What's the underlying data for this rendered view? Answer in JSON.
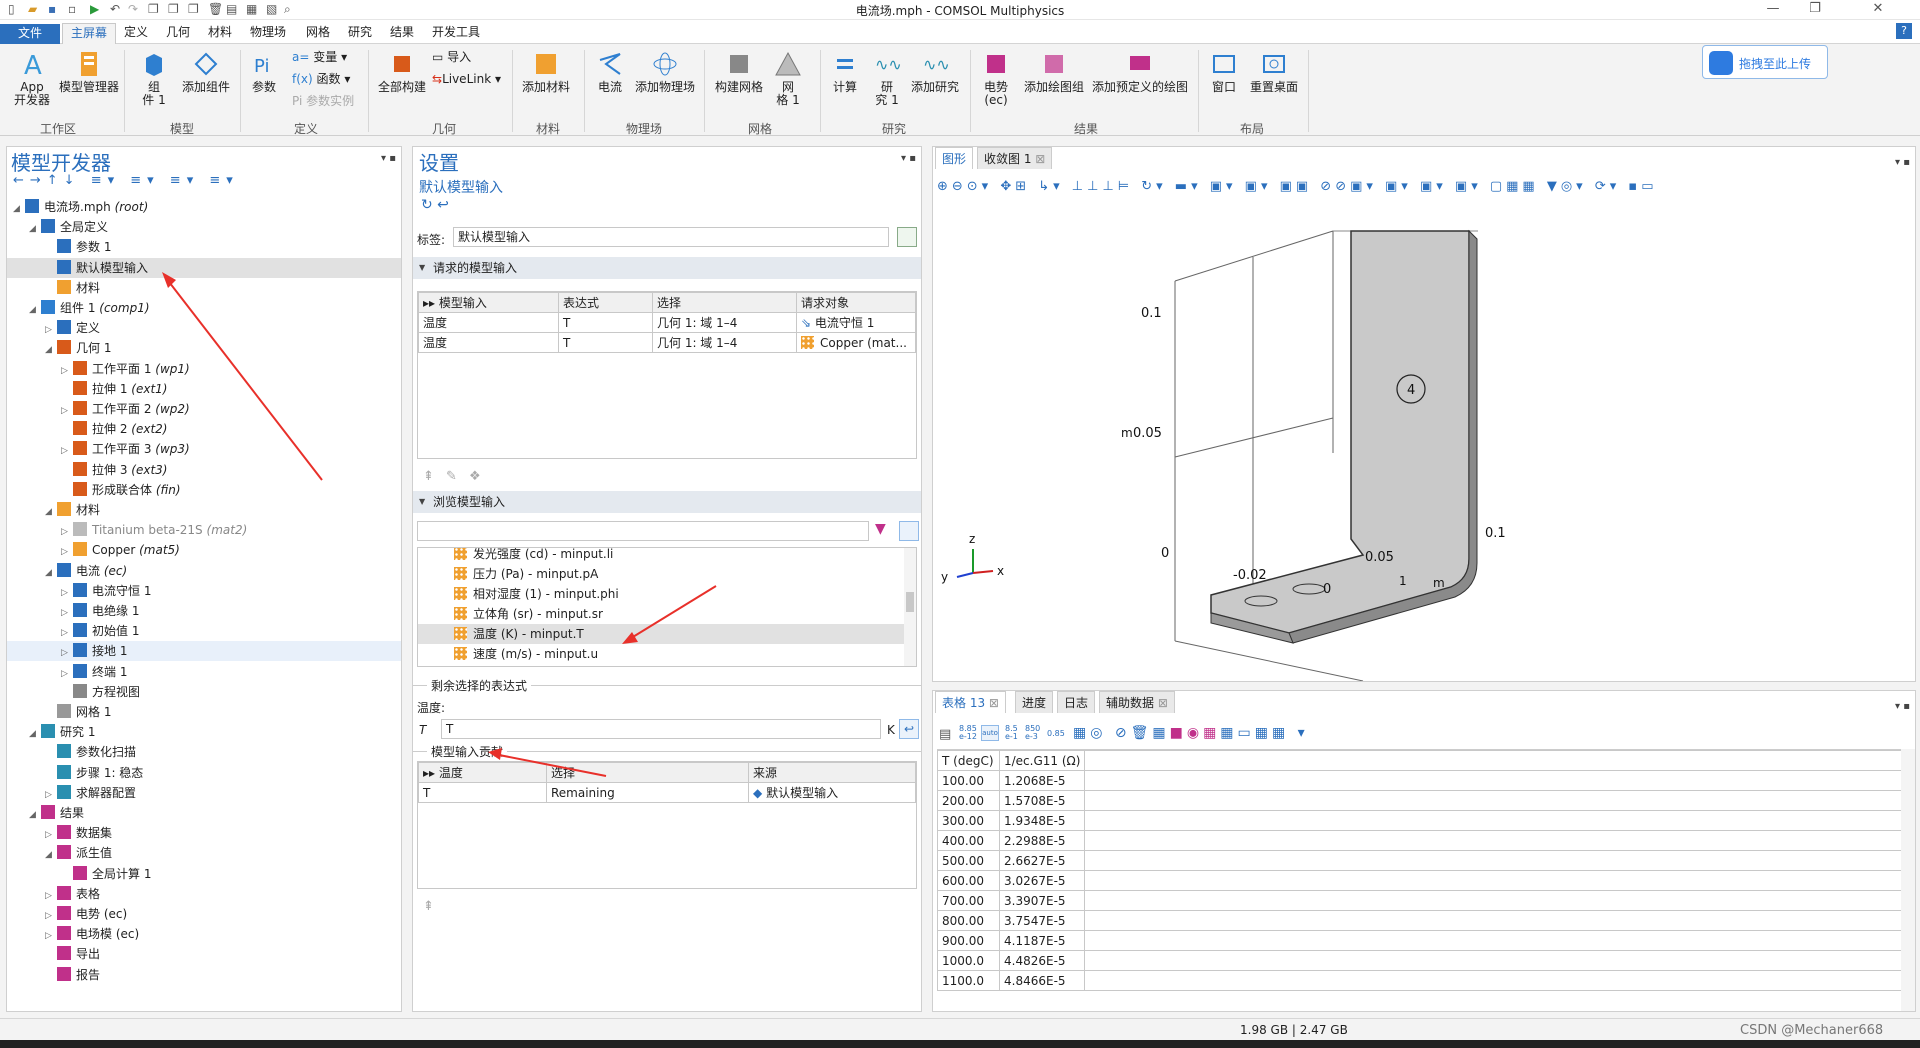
{
  "window": {
    "title": "电流场.mph - COMSOL Multiphysics"
  },
  "menu": {
    "tabs": [
      "文件",
      "主屏幕",
      "定义",
      "几何",
      "材料",
      "物理场",
      "网格",
      "研究",
      "结果",
      "开发工具"
    ],
    "active": "主屏幕",
    "help": "?"
  },
  "ribbon": {
    "buttons": {
      "app": "App\n开发器",
      "model_manager": "模型管理器",
      "component": "组\n件 1",
      "add_component": "添加组件",
      "parameters": "参数",
      "variables": "变量",
      "functions": "函数",
      "param_instance": "参数实例",
      "build_all": "全部构建",
      "import": "导入",
      "livelink": "LiveLink",
      "add_material": "添加材料",
      "current": "电流",
      "add_physics": "添加物理场",
      "build_mesh": "构建网格",
      "mesh": "网\n格 1",
      "compute": "计算",
      "study": "研\n究 1",
      "add_study": "添加研究",
      "potential": "电势\n(ec)",
      "add_plot_group": "添加绘图组",
      "add_predef_plot": "添加预定义的绘图",
      "window": "窗口",
      "reset_desktop": "重置桌面"
    },
    "groups": [
      "工作区",
      "模型",
      "定义",
      "几何",
      "材料",
      "物理场",
      "网格",
      "研究",
      "结果",
      "布局"
    ],
    "upload": "拖拽至此上传"
  },
  "model_builder": {
    "title": "模型开发器",
    "tree": [
      {
        "label": "电流场.mph",
        "tag": "(root)"
      },
      {
        "label": "全局定义",
        "tag": ""
      },
      {
        "label": "参数 1",
        "tag": ""
      },
      {
        "label": "默认模型输入",
        "tag": ""
      },
      {
        "label": "材料",
        "tag": ""
      },
      {
        "label": "组件 1",
        "tag": "(comp1)"
      },
      {
        "label": "定义",
        "tag": ""
      },
      {
        "label": "几何 1",
        "tag": ""
      },
      {
        "label": "工作平面 1",
        "tag": "(wp1)"
      },
      {
        "label": "拉伸 1",
        "tag": "(ext1)"
      },
      {
        "label": "工作平面 2",
        "tag": "(wp2)"
      },
      {
        "label": "拉伸 2",
        "tag": "(ext2)"
      },
      {
        "label": "工作平面 3",
        "tag": "(wp3)"
      },
      {
        "label": "拉伸 3",
        "tag": "(ext3)"
      },
      {
        "label": "形成联合体",
        "tag": "(fin)"
      },
      {
        "label": "材料",
        "tag": ""
      },
      {
        "label": "Titanium beta-21S",
        "tag": "(mat2)"
      },
      {
        "label": "Copper",
        "tag": "(mat5)"
      },
      {
        "label": "电流",
        "tag": "(ec)"
      },
      {
        "label": "电流守恒 1",
        "tag": ""
      },
      {
        "label": "电绝缘 1",
        "tag": ""
      },
      {
        "label": "初始值 1",
        "tag": ""
      },
      {
        "label": "接地 1",
        "tag": ""
      },
      {
        "label": "终端 1",
        "tag": ""
      },
      {
        "label": "方程视图",
        "tag": ""
      },
      {
        "label": "网格 1",
        "tag": ""
      },
      {
        "label": "研究 1",
        "tag": ""
      },
      {
        "label": "参数化扫描",
        "tag": ""
      },
      {
        "label": "步骤 1: 稳态",
        "tag": ""
      },
      {
        "label": "求解器配置",
        "tag": ""
      },
      {
        "label": "结果",
        "tag": ""
      },
      {
        "label": "数据集",
        "tag": ""
      },
      {
        "label": "派生值",
        "tag": ""
      },
      {
        "label": "全局计算 1",
        "tag": ""
      },
      {
        "label": "表格",
        "tag": ""
      },
      {
        "label": "电势 (ec)",
        "tag": ""
      },
      {
        "label": "电场模 (ec)",
        "tag": ""
      },
      {
        "label": "导出",
        "tag": ""
      },
      {
        "label": "报告",
        "tag": ""
      }
    ]
  },
  "settings": {
    "title": "设置",
    "subtitle": "默认模型输入",
    "label_caption": "标签:",
    "label_value": "默认模型输入",
    "requested_section": "请求的模型输入",
    "requested_headers": [
      "模型输入",
      "表达式",
      "选择",
      "请求对象"
    ],
    "requested_rows": [
      [
        "温度",
        "T",
        "几何 1: 域 1–4",
        "电流守恒 1"
      ],
      [
        "温度",
        "T",
        "几何 1: 域 1–4",
        "Copper (mat..."
      ]
    ],
    "browse_section": "浏览模型输入",
    "browse_items": [
      "发光强度 (cd) - minput.li",
      "压力 (Pa) - minput.pA",
      "相对湿度 (1) - minput.phi",
      "立体角 (sr) - minput.sr",
      "温度 (K) - minput.T",
      "速度 (m/s) - minput.u"
    ],
    "expr_section": "剩余选择的表达式",
    "expr_caption": "温度:",
    "expr_symbol": "T",
    "expr_value": "T",
    "expr_unit": "K",
    "contrib_section": "模型输入贡献",
    "contrib_headers": [
      "温度",
      "选择",
      "来源"
    ],
    "contrib_rows": [
      [
        "T",
        "Remaining",
        "默认模型输入"
      ]
    ]
  },
  "graphics": {
    "tabs": [
      "图形",
      "收敛图 1"
    ],
    "axes": {
      "z_ticks": [
        "0.1",
        "0.05",
        "0"
      ],
      "z_label": "m",
      "y_ticks": [
        "-0.02",
        "0"
      ],
      "x_ticks": [
        "0.05",
        "0.1"
      ],
      "x_label": "m",
      "domain_label": "4",
      "small_label": "1"
    },
    "triad": {
      "x": "x",
      "y": "y",
      "z": "z"
    }
  },
  "table_panel": {
    "tabs": [
      "表格 13",
      "进度",
      "日志",
      "辅助数据"
    ],
    "headers": [
      "T (degC)",
      "1/ec.G11 (Ω)"
    ],
    "rows": [
      [
        "100.00",
        "1.2068E-5"
      ],
      [
        "200.00",
        "1.5708E-5"
      ],
      [
        "300.00",
        "1.9348E-5"
      ],
      [
        "400.00",
        "2.2988E-5"
      ],
      [
        "500.00",
        "2.6627E-5"
      ],
      [
        "600.00",
        "3.0267E-5"
      ],
      [
        "700.00",
        "3.3907E-5"
      ],
      [
        "800.00",
        "3.7547E-5"
      ],
      [
        "900.00",
        "4.1187E-5"
      ],
      [
        "1000.0",
        "4.4826E-5"
      ],
      [
        "1100.0",
        "4.8466E-5"
      ]
    ],
    "toolbar_numbers": [
      "8.85\ne-12",
      "8.5\ne-1",
      "850\ne-3",
      "0.85"
    ]
  },
  "status": {
    "memory": "1.98 GB | 2.47 GB",
    "watermark": "CSDN @Mechaner668"
  },
  "colors": {
    "accent": "#2b6fbd",
    "arrow": "#e8302a",
    "material": "#f0a030"
  }
}
